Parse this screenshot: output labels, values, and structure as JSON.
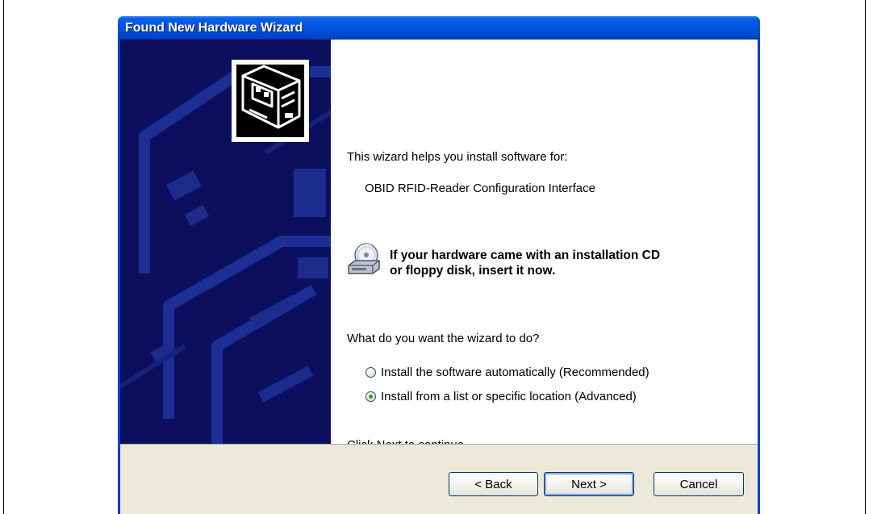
{
  "window": {
    "title": "Found New Hardware Wizard"
  },
  "content": {
    "intro": "This wizard helps you install software for:",
    "device_name": "OBID RFID-Reader Configuration Interface",
    "cd_message_line1": "If your hardware came with an installation CD",
    "cd_message_line2": "or floppy disk, insert it now.",
    "question": "What do you want the wizard to do?",
    "options": [
      {
        "label": "Install the software automatically (Recommended)",
        "selected": false
      },
      {
        "label": "Install from a list or specific location (Advanced)",
        "selected": true
      }
    ],
    "footer_hint": "Click Next to continue."
  },
  "buttons": {
    "back": "< Back",
    "next": "Next >",
    "cancel": "Cancel"
  },
  "icons": {
    "hardware": "hardware-card-icon",
    "cd": "cd-drive-icon"
  },
  "colors": {
    "titlebar": "#0453df",
    "side_panel": "#0b0f5e",
    "button_face": "#ece9d8"
  }
}
